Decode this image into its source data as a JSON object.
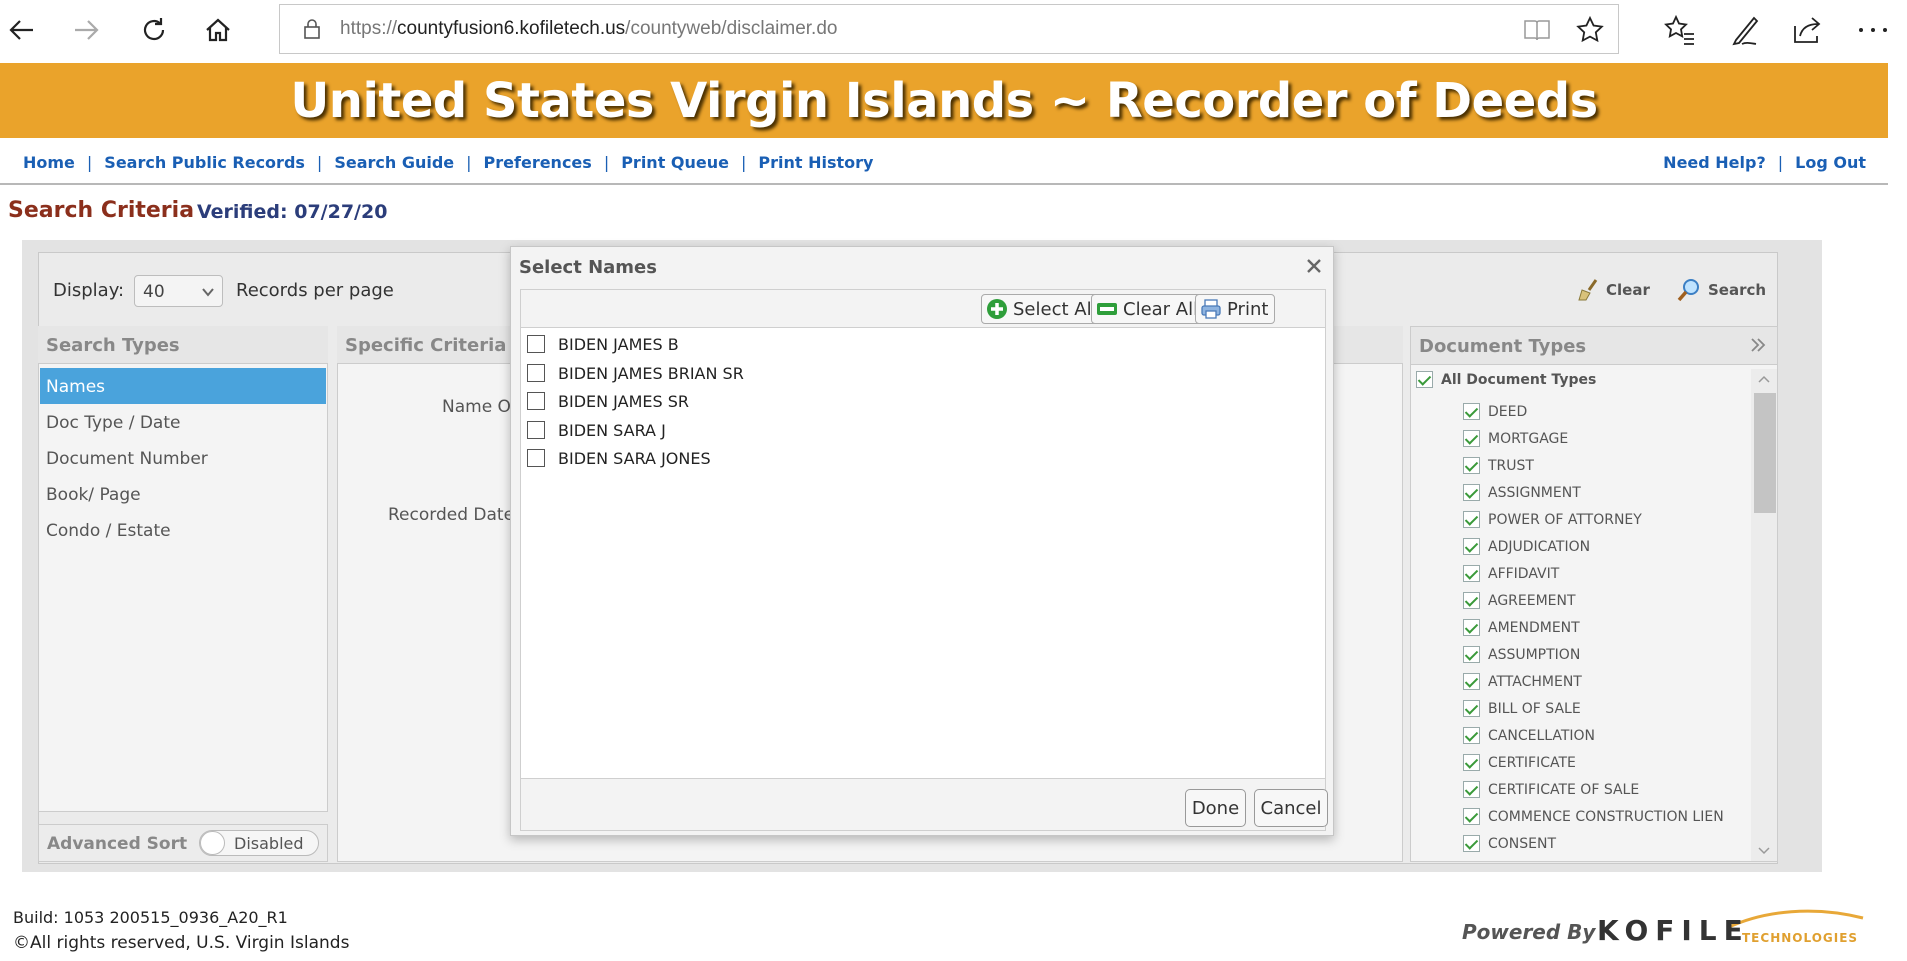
{
  "browser": {
    "url_prefix": "https://",
    "url_host": "countyfusion6.kofiletech.us",
    "url_path": "/countyweb/disclaimer.do"
  },
  "banner": {
    "title": "United States Virgin Islands ~ Recorder of Deeds"
  },
  "topnav": {
    "left": [
      "Home",
      "Search Public Records",
      "Search Guide",
      "Preferences",
      "Print Queue",
      "Print History"
    ],
    "right": [
      "Need Help?",
      "Log Out"
    ],
    "separator": "|"
  },
  "criteria": {
    "title": "Search Criteria",
    "verified": "Verified: 07/27/20"
  },
  "toolbar": {
    "display_label": "Display:",
    "display_value": "40",
    "records_label": "Records per page",
    "clear_label": "Clear",
    "search_label": "Search"
  },
  "search_types": {
    "header": "Search Types",
    "items": [
      "Names",
      "Doc Type / Date",
      "Document Number",
      "Book/ Page",
      "Condo / Estate"
    ],
    "active_index": 0
  },
  "advanced_sort": {
    "label": "Advanced Sort",
    "state": "Disabled"
  },
  "specific_criteria": {
    "header": "Specific Criteria",
    "name_label": "Name O",
    "recorded_date_label": "Recorded Date"
  },
  "document_types": {
    "header": "Document Types",
    "all_label": "All Document Types",
    "items": [
      "DEED",
      "MORTGAGE",
      "TRUST",
      "ASSIGNMENT",
      "POWER OF ATTORNEY",
      "ADJUDICATION",
      "AFFIDAVIT",
      "AGREEMENT",
      "AMENDMENT",
      "ASSUMPTION",
      "ATTACHMENT",
      "BILL OF SALE",
      "CANCELLATION",
      "CERTIFICATE",
      "CERTIFICATE OF SALE",
      "COMMENCE CONSTRUCTION LIEN",
      "CONSENT"
    ]
  },
  "modal": {
    "title": "Select Names",
    "select_all": "Select All",
    "clear_all": "Clear All",
    "print": "Print",
    "names": [
      "BIDEN JAMES B",
      "BIDEN JAMES BRIAN SR",
      "BIDEN JAMES SR",
      "BIDEN SARA J",
      "BIDEN SARA JONES"
    ],
    "done": "Done",
    "cancel": "Cancel"
  },
  "footer": {
    "build": "Build: 1053 200515_0936_A20_R1",
    "copyright": "©All rights reserved, U.S. Virgin Islands",
    "powered_by": "Powered By",
    "brand": "KOFILE",
    "brand_sub": "TECHNOLOGIES"
  },
  "colors": {
    "banner": "#EAA32B",
    "nav_link": "#1a5fb4",
    "criteria_title": "#8B2F1C",
    "active_item": "#4aa3dc"
  }
}
